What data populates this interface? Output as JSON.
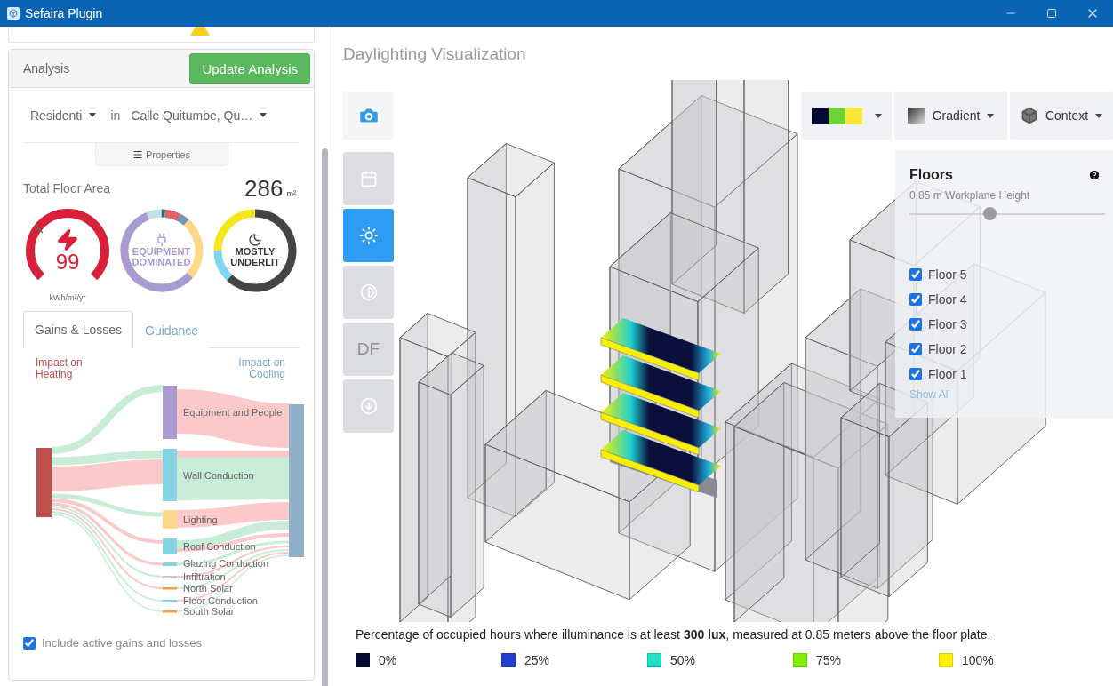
{
  "window": {
    "title": "Sefaira Plugin"
  },
  "analysis": {
    "title": "Analysis",
    "update_button": "Update Analysis",
    "building_type": "Residenti",
    "in_label": "in",
    "location": "Calle Quitumbe, Qu…",
    "properties_tab": "Properties",
    "floor_area_label": "Total Floor Area",
    "floor_area_value": "286",
    "floor_area_unit": "m²"
  },
  "gauges": [
    {
      "kind": "energy",
      "value": "99",
      "unit": "kWh/m²/yr"
    },
    {
      "kind": "equipment",
      "label": "EQUIPMENT DOMINATED"
    },
    {
      "kind": "daylight",
      "label": "MOSTLY UNDERLIT"
    }
  ],
  "tabs": [
    {
      "label": "Gains & Losses",
      "selected": true
    },
    {
      "label": "Guidance",
      "selected": false
    }
  ],
  "sankey": {
    "heating_label": "Impact on Heating",
    "cooling_label": "Impact on Cooling",
    "nodes": [
      {
        "label": "Equipment and People",
        "color": "#a99bd0"
      },
      {
        "label": "Wall Conduction",
        "color": "#86d3e3"
      },
      {
        "label": "Lighting",
        "color": "#fcd98a"
      },
      {
        "label": "Roof Conduction",
        "color": "#86d3e3"
      },
      {
        "label": "Glazing Conduction",
        "color": "#86d3e3"
      },
      {
        "label": "Infiltration",
        "color": "#c8c8c8"
      },
      {
        "label": "North Solar",
        "color": "#f5a03c"
      },
      {
        "label": "Floor Conduction",
        "color": "#86d3e3"
      },
      {
        "label": "South Solar",
        "color": "#f5a03c"
      }
    ]
  },
  "include_active": {
    "label": "Include active gains and losses",
    "checked": true
  },
  "viewport": {
    "title": "Daylighting Visualization",
    "tools": [
      {
        "kind": "calendar",
        "selected": false
      },
      {
        "kind": "sun",
        "selected": true
      },
      {
        "kind": "contrast",
        "selected": false
      },
      {
        "kind": "df",
        "label": "DF",
        "selected": false
      },
      {
        "kind": "download",
        "selected": false
      }
    ],
    "palette": [
      {
        "color": "#050a33"
      },
      {
        "color": "#6fd13c"
      },
      {
        "color": "#f8e83c"
      }
    ],
    "gradient_button": "Gradient",
    "context_button": "Context",
    "floors_panel": {
      "title": "Floors",
      "workplane_label": "0.85 m Workplane Height",
      "level": 0.41,
      "floors": [
        {
          "label": "Floor 5",
          "checked": true
        },
        {
          "label": "Floor 4",
          "checked": true
        },
        {
          "label": "Floor 3",
          "checked": true
        },
        {
          "label": "Floor 2",
          "checked": true
        },
        {
          "label": "Floor 1",
          "checked": true
        }
      ],
      "show_all": "Show All"
    },
    "legend": {
      "caption": "Percentage of occupied hours where illuminance is at least **300 lux**, measured at 0.85 meters above the floor plate.",
      "items": [
        {
          "label": "0%",
          "color": "#050a33"
        },
        {
          "label": "25%",
          "color": "#1f3fcf"
        },
        {
          "label": "50%",
          "color": "#1fe0c8"
        },
        {
          "label": "75%",
          "color": "#80f00a"
        },
        {
          "label": "100%",
          "color": "#fff200"
        }
      ]
    }
  }
}
